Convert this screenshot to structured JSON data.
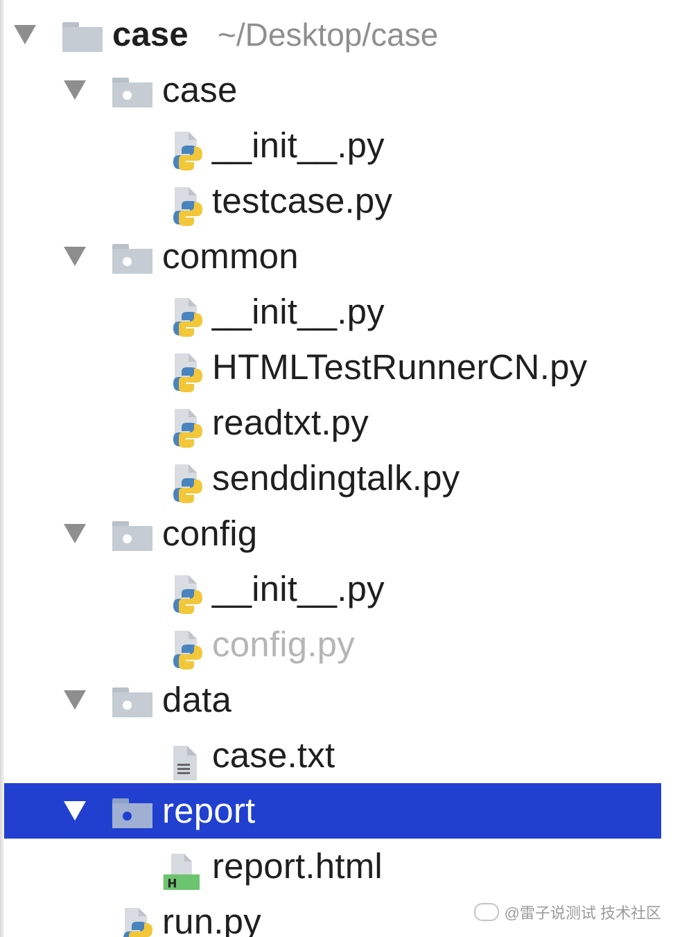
{
  "project": {
    "root_label": "case",
    "root_path": "~/Desktop/case"
  },
  "tree": {
    "folders": {
      "case": "case",
      "common": "common",
      "config": "config",
      "data": "data",
      "report": "report"
    },
    "files": {
      "case_init": "__init__.py",
      "testcase": "testcase.py",
      "common_init": "__init__.py",
      "htmltestrunner": "HTMLTestRunnerCN.py",
      "readtxt": "readtxt.py",
      "senddingtalk": "senddingtalk.py",
      "config_init": "__init__.py",
      "config_py": "config.py",
      "case_txt": "case.txt",
      "report_html": "report.html",
      "run_py": "run.py"
    },
    "selected": "report"
  },
  "watermark": {
    "text": "@雷子说测试 技术社区"
  },
  "colors": {
    "selection": "#2140d0",
    "folder": "#c5ccd3",
    "text": "#1f1f1f",
    "muted": "#8f8f8f"
  }
}
